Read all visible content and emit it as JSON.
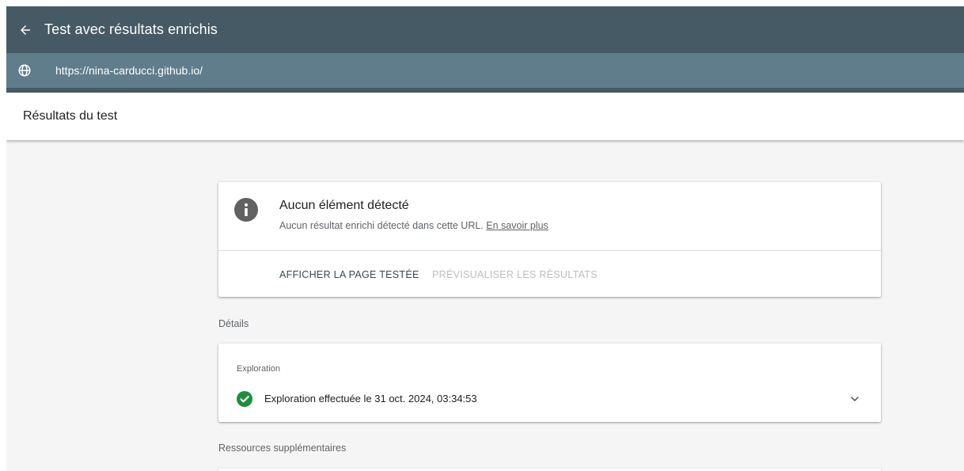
{
  "topbar": {
    "title": "Test avec résultats enrichis",
    "back_icon": "arrow-left-icon"
  },
  "urlbar": {
    "url": "https://nina-carducci.github.io/",
    "icon": "globe-icon"
  },
  "results_header": {
    "title": "Résultats du test"
  },
  "summary_card": {
    "icon": "info-icon",
    "title": "Aucun élément détecté",
    "subtitle": "Aucun résultat enrichi détecté dans cette URL.",
    "learn_more": "En savoir plus",
    "view_page_button": "AFFICHER LA PAGE TESTÉE",
    "preview_button": "PRÉVISUALISER LES RÉSULTATS"
  },
  "details": {
    "label": "Détails",
    "exploration_label": "Exploration",
    "exploration_status": "Exploration effectuée le 31 oct. 2024, 03:34:53",
    "status_icon": "check-circle-icon"
  },
  "resources": {
    "label": "Ressources supplémentaires"
  },
  "colors": {
    "topbar": "#455a64",
    "urlbar": "#607d8b",
    "success": "#1e8e3e",
    "info": "#616161"
  }
}
